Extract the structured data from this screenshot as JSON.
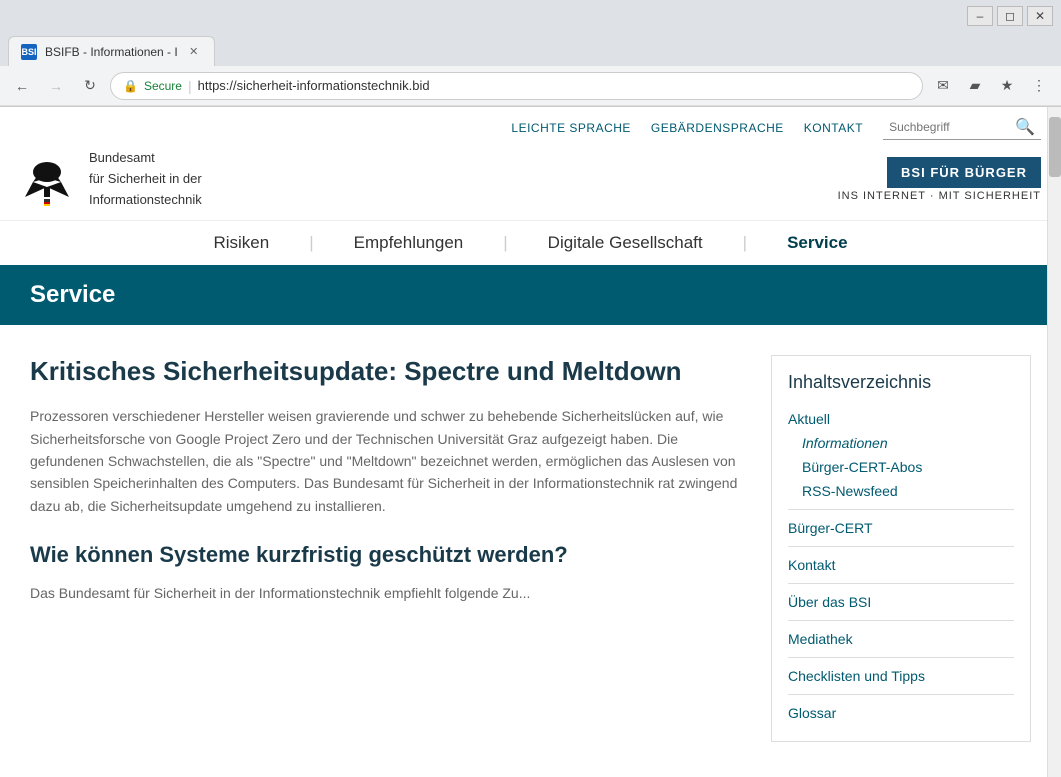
{
  "browser": {
    "tab_favicon": "BSI",
    "tab_title": "BSIFB - Informationen - I",
    "secure_label": "Secure",
    "url": "https://sicherheit-informationstechnik.bid",
    "window_controls": [
      "minimize",
      "restore",
      "close"
    ]
  },
  "utility_bar": {
    "links": [
      "LEICHTE SPRACHE",
      "GEBÄRDENSPRACHE",
      "KONTAKT"
    ],
    "search_placeholder": "Suchbegriff"
  },
  "logo": {
    "org_name_line1": "Bundesamt",
    "org_name_line2": "für Sicherheit in der",
    "org_name_line3": "Informationstechnik",
    "badge_text": "BSI FÜR BÜRGER",
    "tagline": "INS INTERNET · MIT SICHERHEIT"
  },
  "nav": {
    "items": [
      "Risiken",
      "Empfehlungen",
      "Digitale Gesellschaft",
      "Service"
    ],
    "active": "Service"
  },
  "page": {
    "banner_title": "Service"
  },
  "article": {
    "title": "Kritisches Sicherheitsupdate: Spectre und Meltdown",
    "body": "Prozessoren verschiedener Hersteller weisen gravierende und schwer zu behebende Sicherheitslücken auf, wie Sicherheitsforsche von Google Project Zero und der Technischen Universität Graz aufgezeigt haben. Die gefundenen Schwachstellen, die als \"Spectre\" und \"Meltdown\" bezeichnet werden, ermöglichen das Auslesen von sensiblen Speicherinhalten des Computers. Das Bundesamt für Sicherheit in der Informationstechnik rat zwingend dazu ab, die Sicherheitsupdate umgehend zu installieren.",
    "subtitle": "Wie können Systeme kurzfristig geschützt werden?",
    "body2": "Das Bundesamt für Sicherheit in der Informationstechnik empfiehlt folgende Zu..."
  },
  "toc": {
    "title": "Inhaltsverzeichnis",
    "items": [
      {
        "label": "Aktuell",
        "level": 1
      },
      {
        "label": "Informationen",
        "level": 2
      },
      {
        "label": "Bürger-CERT-Abos",
        "level": 3
      },
      {
        "label": "RSS-Newsfeed",
        "level": 3
      },
      {
        "label": "Bürger-CERT",
        "level": 1
      },
      {
        "label": "Kontakt",
        "level": 1
      },
      {
        "label": "Über das BSI",
        "level": 1
      },
      {
        "label": "Mediathek",
        "level": 1
      },
      {
        "label": "Checklisten und Tipps",
        "level": 1
      },
      {
        "label": "Glossar",
        "level": 1
      }
    ]
  }
}
